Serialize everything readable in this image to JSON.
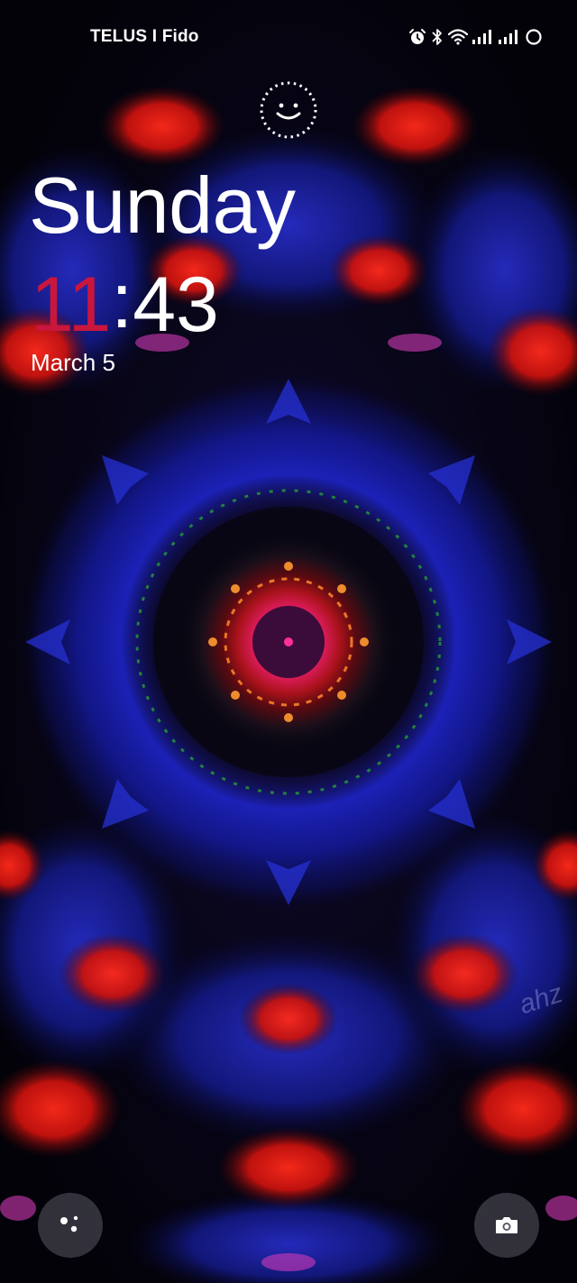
{
  "status_bar": {
    "carrier": "TELUS I Fido",
    "icons": [
      "alarm-icon",
      "bluetooth-icon",
      "wifi-icon",
      "signal-icon",
      "signal-icon",
      "battery-ring-icon"
    ]
  },
  "lock_screen": {
    "day": "Sunday",
    "time_hours": "11",
    "time_separator": ":",
    "time_minutes": "43",
    "date": "March 5"
  },
  "shortcuts": {
    "left": "assistant-icon",
    "right": "camera-icon"
  },
  "wallpaper": {
    "watermark": "ahz"
  },
  "colors": {
    "hours_accent": "#c8163d",
    "text": "#ffffff",
    "wallpaper_blue": "#1c22c9",
    "wallpaper_red": "#d21414"
  }
}
